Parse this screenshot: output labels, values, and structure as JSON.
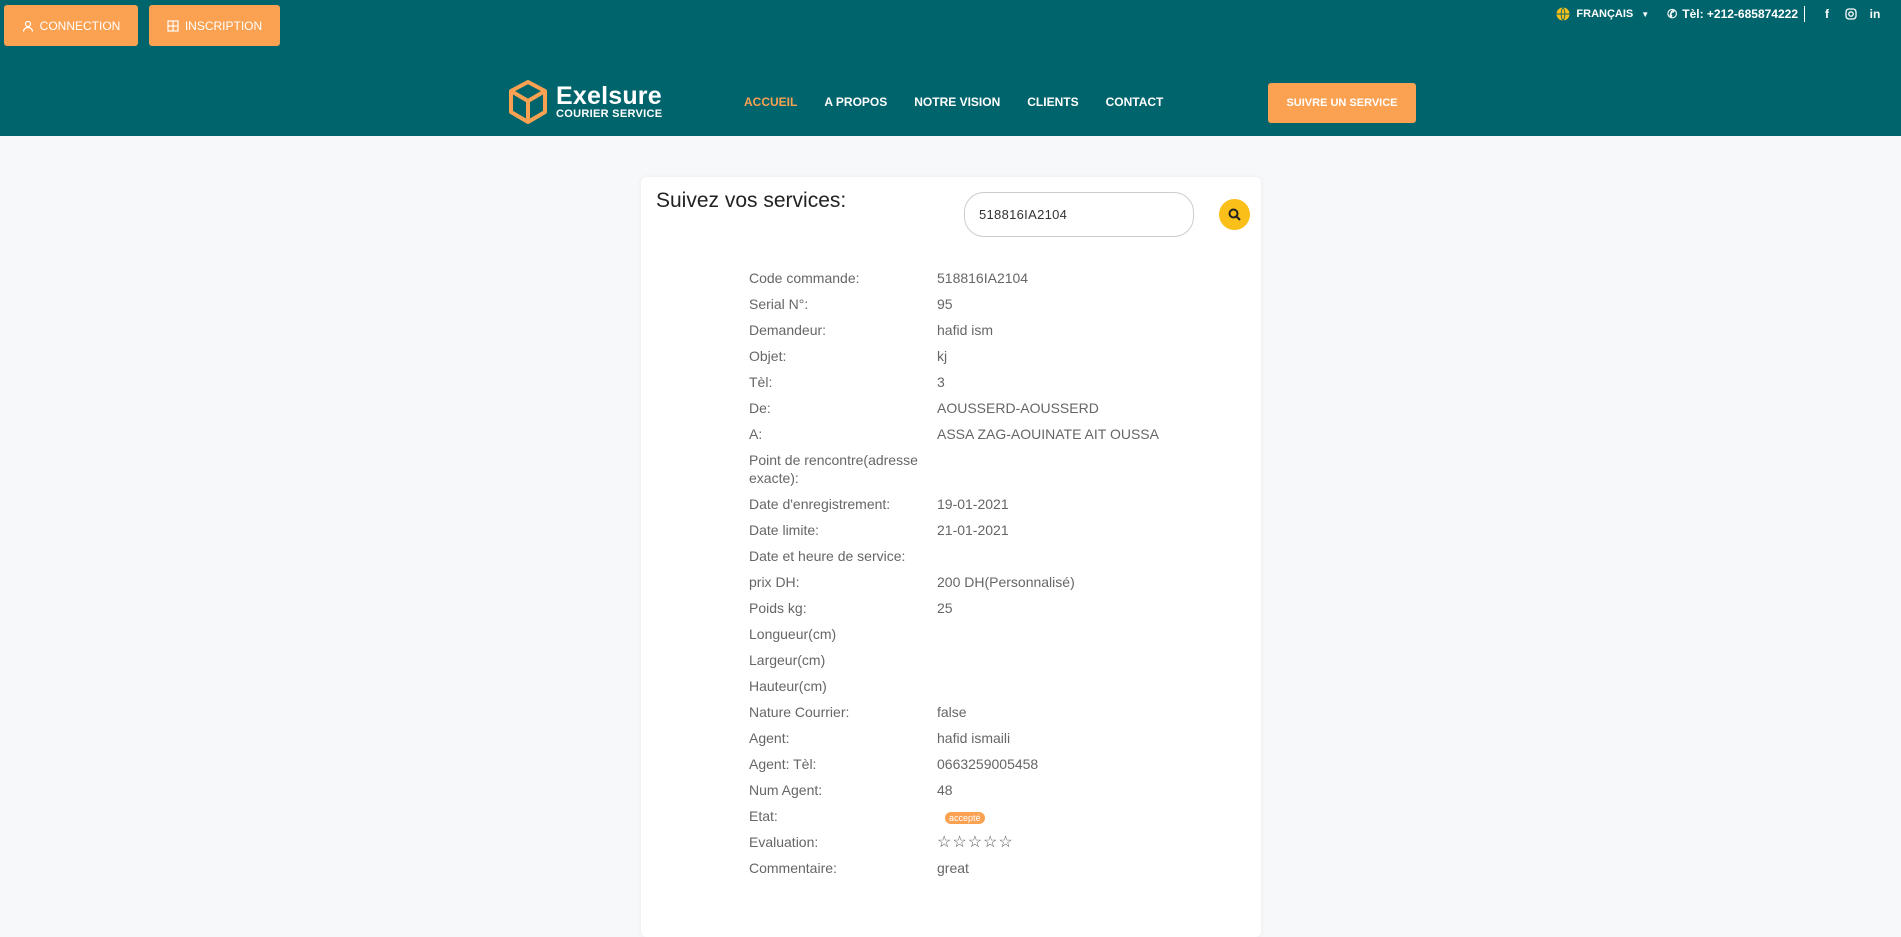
{
  "topbar": {
    "connection_label": "CONNECTION",
    "inscription_label": "INSCRIPTION",
    "language": "FRANÇAIS",
    "phone": "Tèl: +212-685874222",
    "social": [
      "f",
      "ig",
      "in"
    ]
  },
  "logo": {
    "brand": "Exelsure",
    "tagline": "COURIER SERVICE"
  },
  "nav": {
    "items": [
      "ACCUEIL",
      "A PROPOS",
      "NOTRE VISION",
      "CLIENTS",
      "CONTACT"
    ],
    "active": "ACCUEIL",
    "cta": "SUIVRE UN SERVICE"
  },
  "tracking": {
    "title": "Suivez vos services:",
    "search_value": "518816IA2104",
    "details": [
      {
        "label": "Code commande:",
        "value": "518816IA2104"
      },
      {
        "label": "Serial N°:",
        "value": "95"
      },
      {
        "label": "Demandeur:",
        "value": "hafid ism"
      },
      {
        "label": "Objet:",
        "value": "kj"
      },
      {
        "label": "Tèl:",
        "value": "3"
      },
      {
        "label": "De:",
        "value": "AOUSSERD-AOUSSERD"
      },
      {
        "label": "A:",
        "value": "ASSA ZAG-AOUINATE AIT OUSSA"
      },
      {
        "label": "Point de rencontre(adresse exacte):",
        "value": ""
      },
      {
        "label": "Date d'enregistrement:",
        "value": "19-01-2021"
      },
      {
        "label": "Date limite:",
        "value": "21-01-2021"
      },
      {
        "label": "Date et heure de service:",
        "value": ""
      },
      {
        "label": "prix DH:",
        "value": "200 DH(Personnalisé)"
      },
      {
        "label": "Poids kg:",
        "value": "25"
      },
      {
        "label": "Longueur(cm)",
        "value": ""
      },
      {
        "label": "Largeur(cm)",
        "value": ""
      },
      {
        "label": "Hauteur(cm)",
        "value": ""
      },
      {
        "label": "Nature Courrier:",
        "value": "false"
      },
      {
        "label": "Agent:",
        "value": "hafid ismaili"
      },
      {
        "label": "Agent: Tèl:",
        "value": "0663259005458"
      },
      {
        "label": "Num Agent:",
        "value": "48"
      }
    ],
    "etat_label": "Etat:",
    "etat_value": "accepté",
    "evaluation_label": "Evaluation:",
    "evaluation_stars": 0,
    "evaluation_max": 5,
    "commentaire_label": "Commentaire:",
    "commentaire_value": "great"
  },
  "colors": {
    "header": "#00646c",
    "accent": "#fba152",
    "search_button": "#fbbf19"
  }
}
